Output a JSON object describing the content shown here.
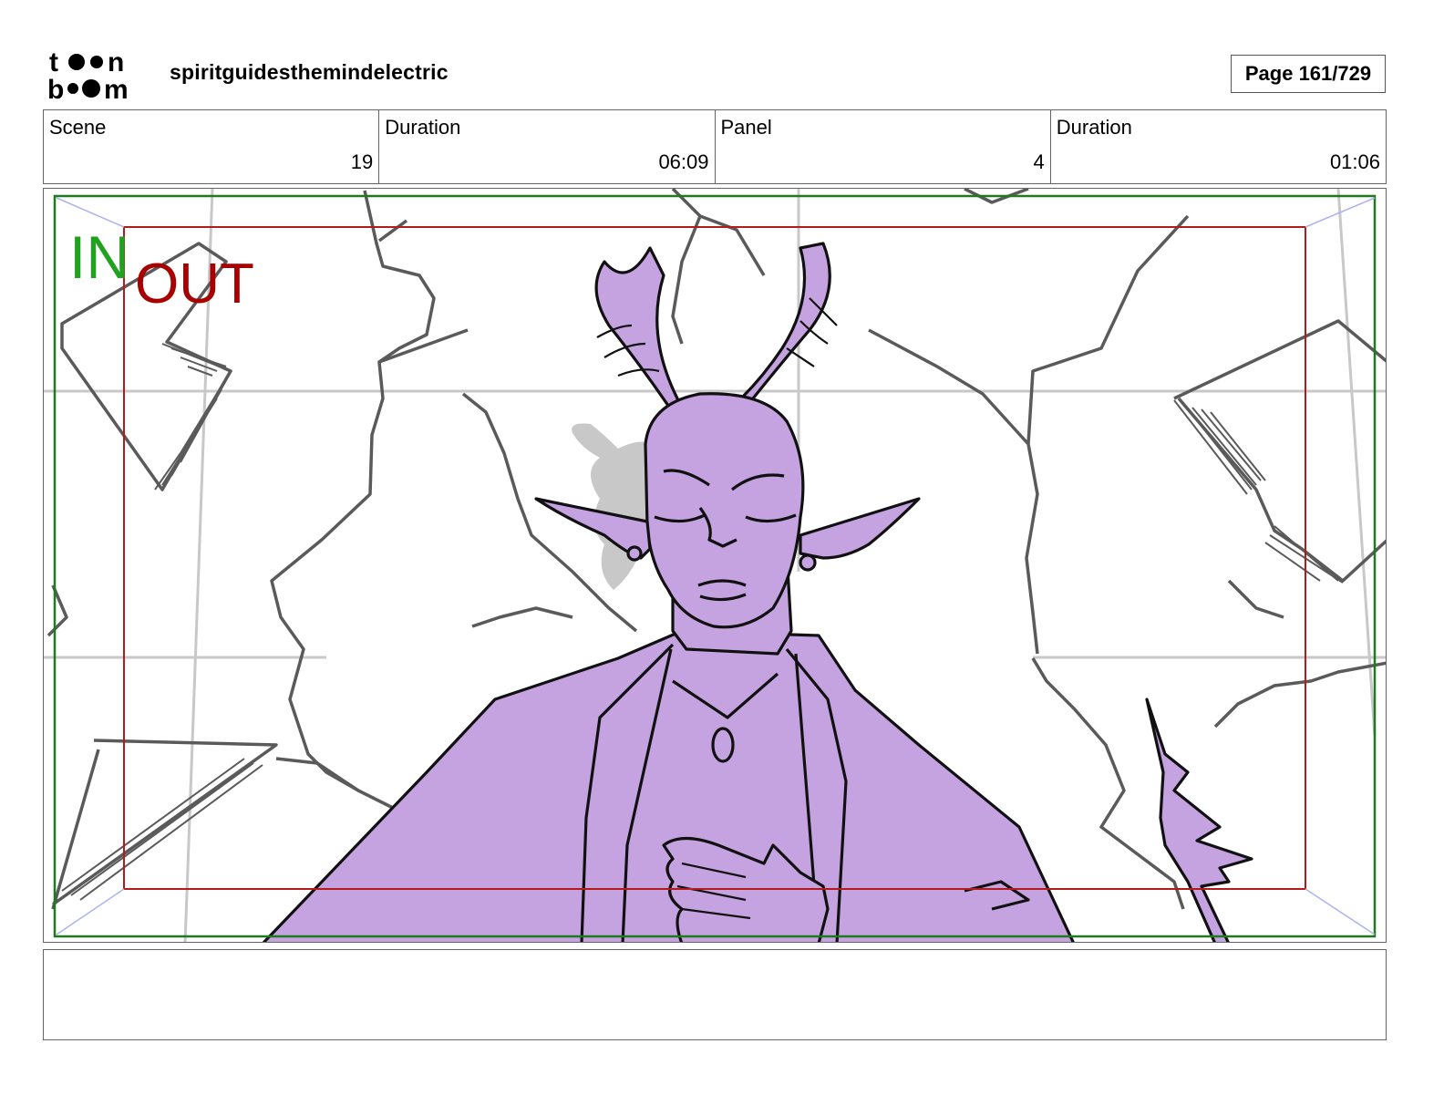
{
  "header": {
    "logo_text": "toon boom",
    "project_name": "spiritguidesthemindelectric",
    "page_label": "Page 161/729"
  },
  "info": {
    "scene_label": "Scene",
    "scene_value": "19",
    "scene_duration_label": "Duration",
    "scene_duration_value": "06:09",
    "panel_label": "Panel",
    "panel_value": "4",
    "panel_duration_label": "Duration",
    "panel_duration_value": "01:06"
  },
  "panel_image": {
    "in_label": "IN",
    "out_label": "OUT",
    "in_color": "#1fa31f",
    "out_color": "#a80000",
    "character_fill": "#c4a3e0"
  },
  "notes": {
    "text": ""
  }
}
